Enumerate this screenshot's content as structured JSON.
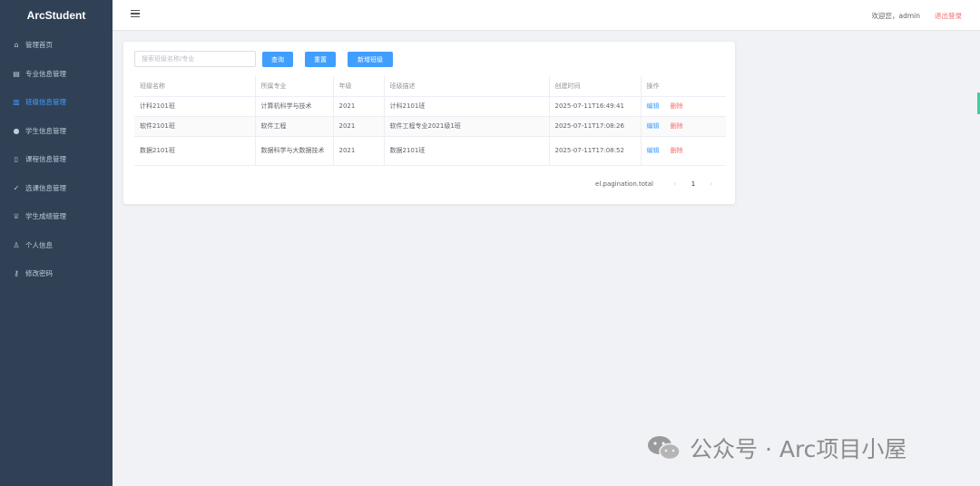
{
  "sidebar": {
    "brand": "ArcStudent",
    "items": [
      {
        "label": "管理首页",
        "icon": "home-icon",
        "glyph": "⌂",
        "active": false
      },
      {
        "label": "专业信息管理",
        "icon": "document-icon",
        "glyph": "▤",
        "active": false
      },
      {
        "label": "班级信息管理",
        "icon": "list-icon",
        "glyph": "▥",
        "active": true
      },
      {
        "label": "学生信息管理",
        "icon": "user-icon",
        "glyph": "●",
        "active": false
      },
      {
        "label": "课程信息管理",
        "icon": "book-icon",
        "glyph": "▯",
        "active": false
      },
      {
        "label": "选课信息管理",
        "icon": "check-icon",
        "glyph": "✓",
        "active": false
      },
      {
        "label": "学生成绩管理",
        "icon": "trophy-icon",
        "glyph": "♕",
        "active": false
      },
      {
        "label": "个人信息",
        "icon": "person-icon",
        "glyph": "♙",
        "active": false
      },
      {
        "label": "修改密码",
        "icon": "key-icon",
        "glyph": "⚷",
        "active": false
      }
    ]
  },
  "header": {
    "welcome": "欢迎您，admin",
    "logout": "退出登录"
  },
  "toolbar": {
    "search_placeholder": "搜索班级名称/专业",
    "search_label": "查询",
    "reset_label": "重置",
    "add_label": "新增班级"
  },
  "table": {
    "headers": [
      "班级名称",
      "所属专业",
      "年级",
      "班级描述",
      "创建时间",
      "操作"
    ],
    "rows": [
      {
        "name": "计科2101班",
        "major": "计算机科学与技术",
        "grade": "2021",
        "desc": "计科2101班",
        "time": "2025-07-11T16:49:41",
        "edit": "编辑",
        "del": "删除"
      },
      {
        "name": "软件2101班",
        "major": "软件工程",
        "grade": "2021",
        "desc": "软件工程专业2021级1班",
        "time": "2025-07-11T17:08:26",
        "edit": "编辑",
        "del": "删除"
      },
      {
        "name": "数据2101班",
        "major": "数据科学与大数据技术",
        "grade": "2021",
        "desc": "数据2101班",
        "time": "2025-07-11T17:08:52",
        "edit": "编辑",
        "del": "删除"
      }
    ]
  },
  "pagination": {
    "total_text": "el.pagination.total",
    "prev": "‹",
    "current": "1",
    "next": "›"
  },
  "watermark": {
    "text": "公众号 · Arc项目小屋"
  },
  "colors": {
    "sidebar_bg": "#304156",
    "primary": "#409eff",
    "danger": "#f56c6c"
  }
}
